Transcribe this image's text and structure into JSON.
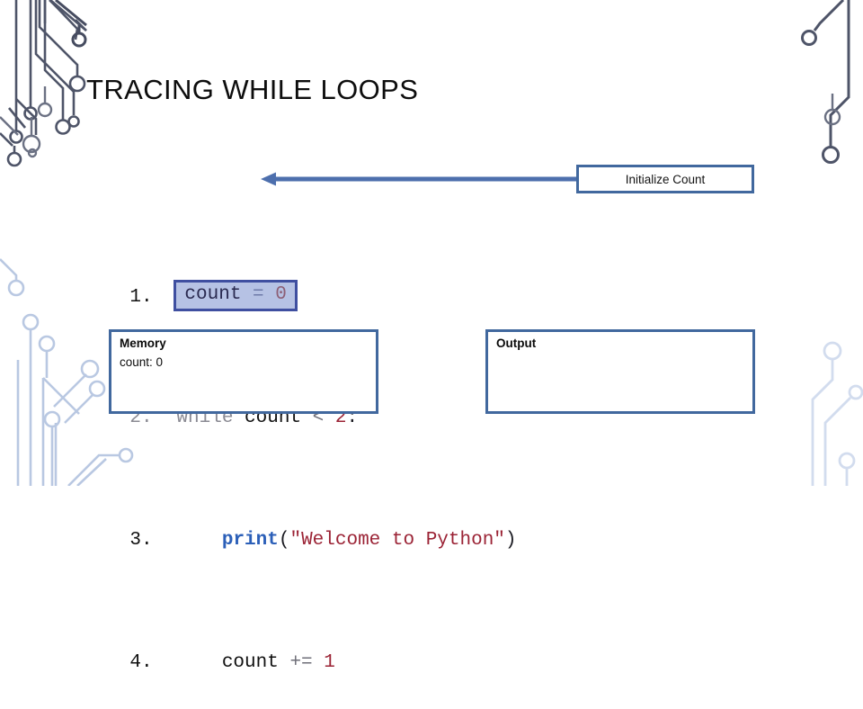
{
  "slide": {
    "title": "TRACING WHILE LOOPS"
  },
  "code": {
    "lines": [
      {
        "number": "1.",
        "highlighted": true,
        "text": "count = 0",
        "tokens": [
          {
            "t": "count",
            "k": "plain"
          },
          {
            "t": " ",
            "k": "plain"
          },
          {
            "t": "=",
            "k": "op"
          },
          {
            "t": " ",
            "k": "plain"
          },
          {
            "t": "0",
            "k": "num"
          }
        ]
      },
      {
        "number": "2.",
        "highlighted": false,
        "text": "while count < 2:",
        "tokens": [
          {
            "t": "while",
            "k": "kw"
          },
          {
            "t": " count ",
            "k": "plain"
          },
          {
            "t": "<",
            "k": "op"
          },
          {
            "t": " ",
            "k": "plain"
          },
          {
            "t": "2",
            "k": "num"
          },
          {
            "t": ":",
            "k": "punc"
          }
        ]
      },
      {
        "number": "3.",
        "highlighted": false,
        "text": "    print(\"Welcome to Python\")",
        "tokens": [
          {
            "t": "    ",
            "k": "plain"
          },
          {
            "t": "print",
            "k": "fn"
          },
          {
            "t": "(",
            "k": "punc"
          },
          {
            "t": "\"Welcome to Python\"",
            "k": "str"
          },
          {
            "t": ")",
            "k": "punc"
          }
        ]
      },
      {
        "number": "4.",
        "highlighted": false,
        "text": "    count += 1",
        "tokens": [
          {
            "t": "    count ",
            "k": "plain"
          },
          {
            "t": "+=",
            "k": "op"
          },
          {
            "t": " ",
            "k": "plain"
          },
          {
            "t": "1",
            "k": "num"
          }
        ]
      }
    ]
  },
  "callout": {
    "label": "Initialize Count",
    "points_to_line": "1."
  },
  "panels": {
    "memory": {
      "title": "Memory",
      "body": "count: 0"
    },
    "output": {
      "title": "Output",
      "body": ""
    }
  },
  "colors": {
    "panel_border": "#41689e",
    "callout_border": "#41689e",
    "arrow": "#4d6fad",
    "highlight_fill": "#b6c2e4",
    "highlight_border": "#3f4fa0",
    "keyword": "#8a8a93",
    "function": "#2b5fb8",
    "string": "#9b2335",
    "number": "#9b2335",
    "circuit_dark": "#4e5468",
    "circuit_light": "#cfdaee",
    "background": "#ffffff"
  },
  "decor": {
    "name": "circuit-board-traces",
    "corners": [
      "top-left",
      "top-right",
      "bottom-left",
      "bottom-right"
    ]
  }
}
